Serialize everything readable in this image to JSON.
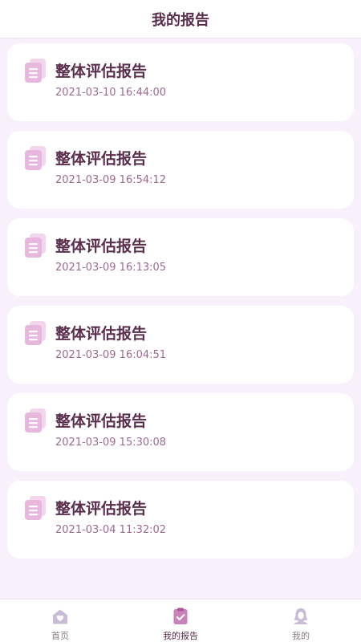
{
  "header": {
    "title": "我的报告"
  },
  "reports": [
    {
      "title": "整体评估报告",
      "time": "2021-03-10 16:44:00"
    },
    {
      "title": "整体评估报告",
      "time": "2021-03-09 16:54:12"
    },
    {
      "title": "整体评估报告",
      "time": "2021-03-09 16:13:05"
    },
    {
      "title": "整体评估报告",
      "time": "2021-03-09 16:04:51"
    },
    {
      "title": "整体评估报告",
      "time": "2021-03-09 15:30:08"
    },
    {
      "title": "整体评估报告",
      "time": "2021-03-04 11:32:02"
    }
  ],
  "tabbar": {
    "items": [
      {
        "label": "首页",
        "icon": "home-icon",
        "active": false
      },
      {
        "label": "我的报告",
        "icon": "report-clipboard-icon",
        "active": true
      },
      {
        "label": "我的",
        "icon": "user-icon",
        "active": false
      }
    ]
  },
  "colors": {
    "accent": "#5a2e4d",
    "icon_pink": "#e8b7dd",
    "background": "#f8f1fb",
    "time_text": "#9b6a91"
  }
}
